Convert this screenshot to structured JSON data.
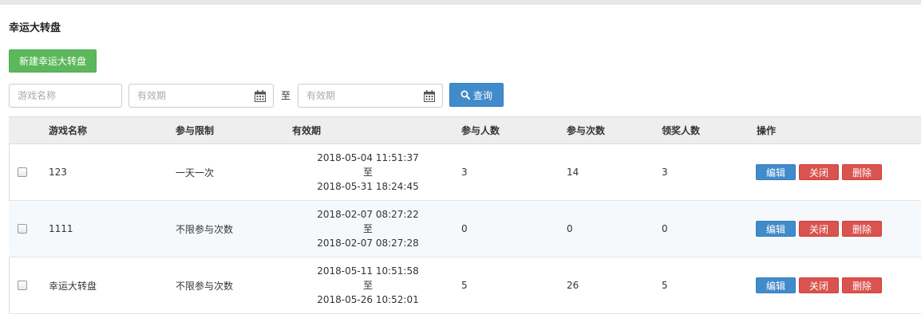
{
  "page": {
    "title": "幸运大转盘"
  },
  "toolbar": {
    "new_label": "新建幸运大转盘"
  },
  "filters": {
    "name_placeholder": "游戏名称",
    "start_placeholder": "有效期",
    "to_label": "至",
    "end_placeholder": "有效期",
    "search_label": "查询"
  },
  "table": {
    "headers": {
      "name": "游戏名称",
      "limit": "参与限制",
      "validity": "有效期",
      "participants": "参与人数",
      "times": "参与次数",
      "winners": "领奖人数",
      "actions": "操作"
    },
    "rows": [
      {
        "name": "123",
        "limit": "一天一次",
        "start": "2018-05-04 11:51:37",
        "sep": "至",
        "end": "2018-05-31 18:24:45",
        "participants": "3",
        "times": "14",
        "winners": "3",
        "edit": "编辑",
        "close": "关闭",
        "delete": "删除"
      },
      {
        "name": "1111",
        "limit": "不限参与次数",
        "start": "2018-02-07 08:27:22",
        "sep": "至",
        "end": "2018-02-07 08:27:28",
        "participants": "0",
        "times": "0",
        "winners": "0",
        "edit": "编辑",
        "close": "关闭",
        "delete": "删除"
      },
      {
        "name": "幸运大转盘",
        "limit": "不限参与次数",
        "start": "2018-05-11 10:51:58",
        "sep": "至",
        "end": "2018-05-26 10:52:01",
        "participants": "5",
        "times": "26",
        "winners": "5",
        "edit": "编辑",
        "close": "关闭",
        "delete": "删除"
      }
    ]
  },
  "colors": {
    "green": "#5cb85c",
    "blue": "#428bca",
    "red": "#d9534f",
    "header_bg": "#eeeeee",
    "alt_row": "#f5f9fc"
  },
  "icons": {
    "calendar": "calendar-icon",
    "search": "search-icon"
  }
}
